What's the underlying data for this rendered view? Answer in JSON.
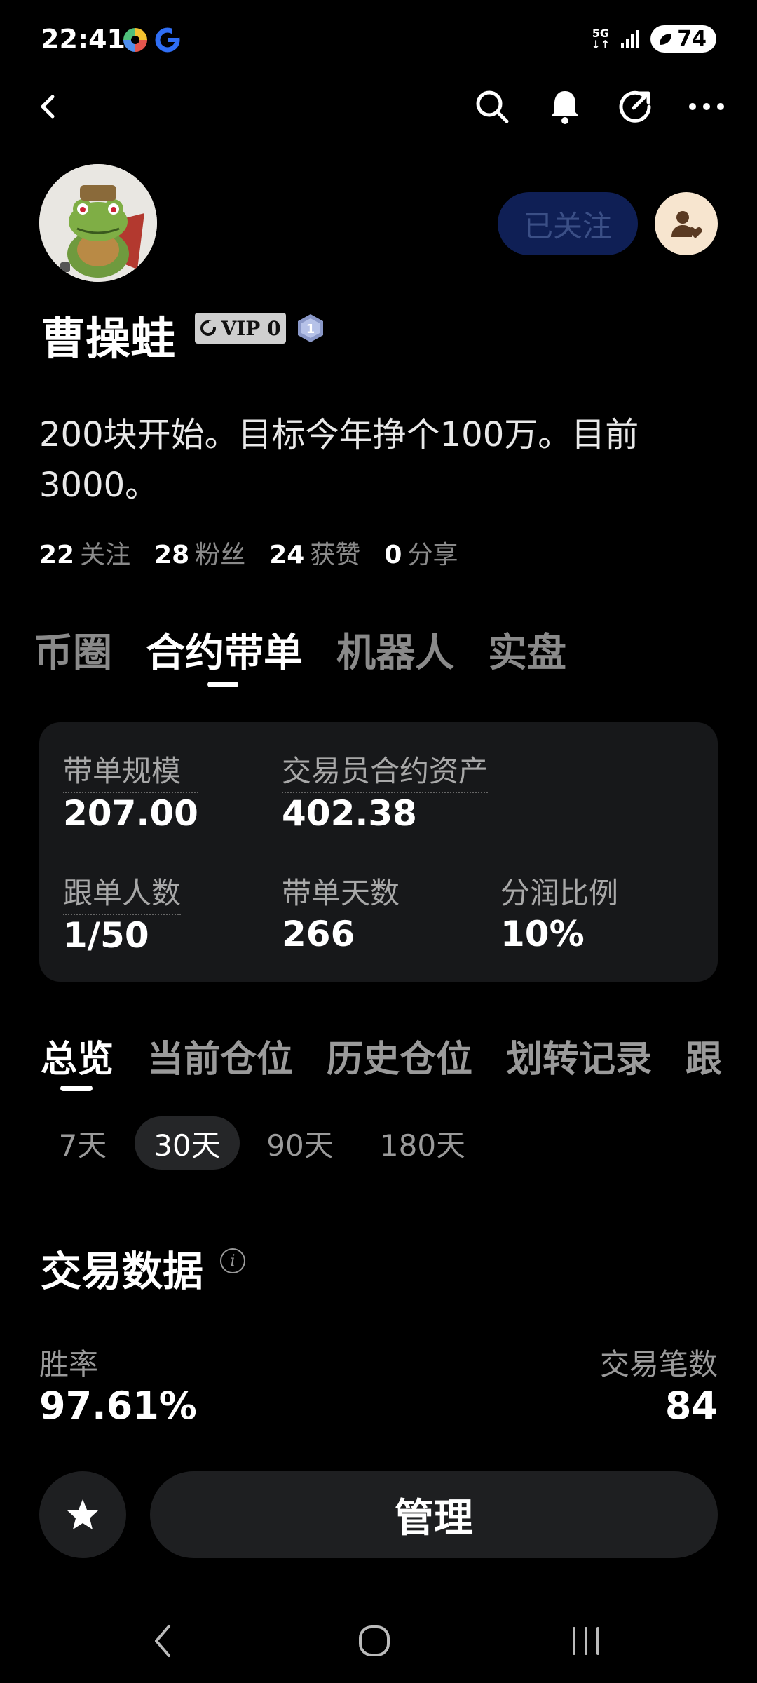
{
  "status_bar": {
    "time": "22:41",
    "network": "5G",
    "battery": "74"
  },
  "header": {
    "back_icon": "chevron-left-icon",
    "search_icon": "search-icon",
    "bell_icon": "bell-icon",
    "share_icon": "share-icon",
    "more_icon": "more-horizontal-icon"
  },
  "profile": {
    "follow_label": "已关注",
    "username": "曹操蛙",
    "vip_label": "VIP 0",
    "level": "1",
    "bio": "200块开始。目标今年挣个100万。目前3000。",
    "stats": [
      {
        "num": "22",
        "label": "关注"
      },
      {
        "num": "28",
        "label": "粉丝"
      },
      {
        "num": "24",
        "label": "获赞"
      },
      {
        "num": "0",
        "label": "分享"
      }
    ]
  },
  "main_tabs": [
    "币圈",
    "合约带单",
    "机器人",
    "实盘"
  ],
  "card": {
    "scale_label": "带单规模",
    "scale_value": "207.00",
    "assets_label": "交易员合约资产",
    "assets_value": "402.38",
    "followers_label": "跟单人数",
    "followers_value": "1/50",
    "days_label": "带单天数",
    "days_value": "266",
    "share_label": "分润比例",
    "share_value": "10%"
  },
  "sub_tabs": [
    "总览",
    "当前仓位",
    "历史仓位",
    "划转记录",
    "跟"
  ],
  "periods": [
    "7天",
    "30天",
    "90天",
    "180天"
  ],
  "trade_data": {
    "title": "交易数据",
    "info_icon_text": "i",
    "win_rate_label": "胜率",
    "win_rate_value": "97.61%",
    "trades_label": "交易笔数",
    "trades_value": "84"
  },
  "bottom": {
    "manage_label": "管理"
  },
  "colors": {
    "background": "#000000",
    "card": "#17181a",
    "follow_bg": "#0f1f55",
    "follow_text": "#3b4f86",
    "person_btn": "#f7e5cf"
  }
}
